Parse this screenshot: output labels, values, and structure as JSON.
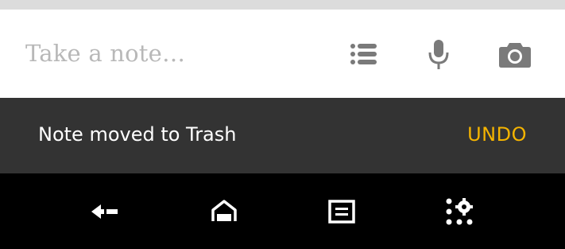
{
  "note_bar": {
    "placeholder": "Take a note…",
    "icons": [
      "list-icon",
      "microphone-icon",
      "camera-icon"
    ]
  },
  "snackbar": {
    "message": "Note moved to Trash",
    "action_label": "UNDO",
    "action_color": "#f5b400"
  },
  "nav_bar": {
    "icons": [
      "back-icon",
      "home-icon",
      "recents-icon",
      "settings-icon"
    ]
  },
  "colors": {
    "snackbar_bg": "#333333",
    "icon_gray": "#7a7a7a",
    "placeholder_gray": "#b8b8b8"
  }
}
